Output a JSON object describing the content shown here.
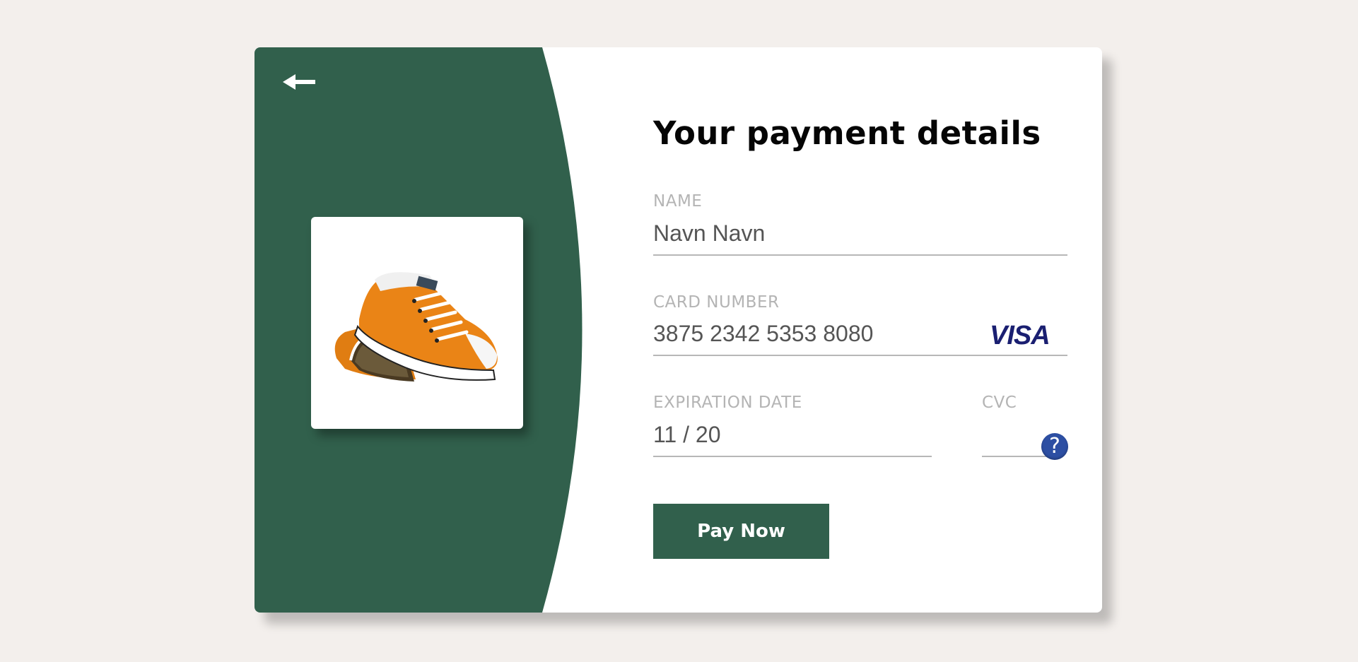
{
  "colors": {
    "accent": "#31604c",
    "background": "#f3efec",
    "visa": "#1a1f71",
    "help": "#2d4fa3"
  },
  "header": {
    "back_icon": "arrow-left-icon"
  },
  "product": {
    "image": "orange-sneakers-image"
  },
  "form": {
    "title": "Your payment details",
    "name": {
      "label": "NAME",
      "value": "Navn Navn"
    },
    "card_number": {
      "label": "CARD NUMBER",
      "value": "3875 2342 5353 8080",
      "brand": "VISA"
    },
    "expiration": {
      "label": "EXPIRATION DATE",
      "value": "11 / 20"
    },
    "cvc": {
      "label": "CVC",
      "value": "",
      "help_icon": "question-icon",
      "help_glyph": "?"
    },
    "submit_label": "Pay Now"
  }
}
